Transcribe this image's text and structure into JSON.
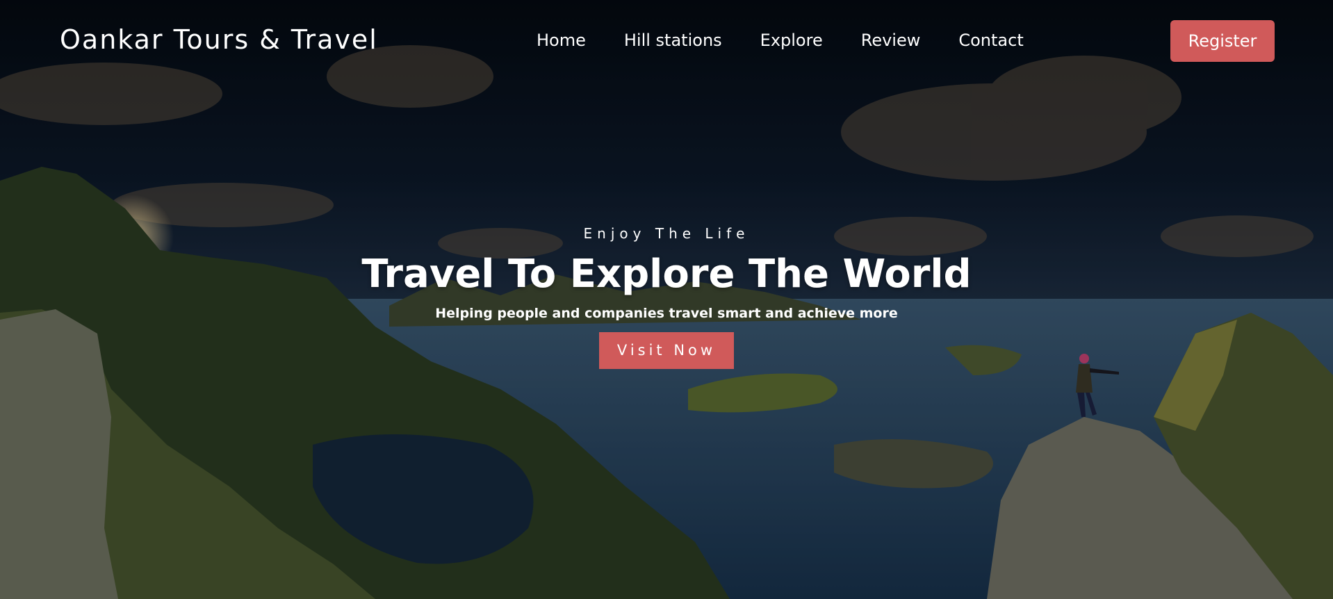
{
  "header": {
    "logo_text": "Oankar Tours & Travel",
    "nav": [
      {
        "label": "Home"
      },
      {
        "label": "Hill stations"
      },
      {
        "label": "Explore"
      },
      {
        "label": "Review"
      },
      {
        "label": "Contact"
      }
    ],
    "register_label": "Register"
  },
  "hero": {
    "tagline": "Enjoy The Life",
    "headline": "Travel To Explore The World",
    "subtitle": "Helping people and companies travel smart and achieve more",
    "cta_label": "Visit Now"
  },
  "colors": {
    "accent": "#d05a5a",
    "text": "#ffffff"
  }
}
